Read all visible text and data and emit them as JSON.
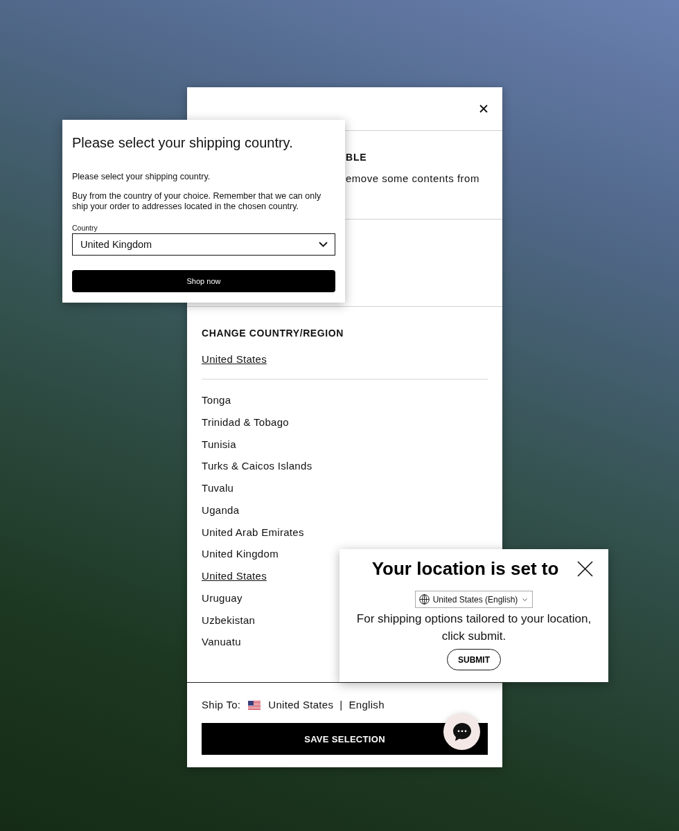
{
  "main_panel": {
    "notice": {
      "heading": "BLE",
      "text": "emove some contents from"
    },
    "change_country": {
      "heading": "CHANGE COUNTRY/REGION",
      "current_country": "United States",
      "countries": [
        {
          "name": "Tonga",
          "selected": false
        },
        {
          "name": "Trinidad & Tobago",
          "selected": false
        },
        {
          "name": "Tunisia",
          "selected": false
        },
        {
          "name": "Turks & Caicos Islands",
          "selected": false
        },
        {
          "name": "Tuvalu",
          "selected": false
        },
        {
          "name": "Uganda",
          "selected": false
        },
        {
          "name": "United Arab Emirates",
          "selected": false
        },
        {
          "name": "United Kingdom",
          "selected": false
        },
        {
          "name": "United States",
          "selected": true
        },
        {
          "name": "Uruguay",
          "selected": false
        },
        {
          "name": "Uzbekistan",
          "selected": false
        },
        {
          "name": "Vanuatu",
          "selected": false
        }
      ]
    },
    "footer": {
      "ship_to_label": "Ship To:",
      "country": "United States",
      "separator": "|",
      "language": "English",
      "save_button": "SAVE SELECTION"
    }
  },
  "shipping_popup": {
    "title": "Please select your shipping country.",
    "subtitle": "Please select your shipping country.",
    "text": "Buy from the country of your choice. Remember that we can only ship your order to addresses located in the chosen country.",
    "country_label": "Country",
    "country_value": "United Kingdom",
    "button": "Shop now"
  },
  "location_popup": {
    "title": "Your location is set to",
    "locale": "United States (English)",
    "text": "For shipping options tailored to your location, click submit.",
    "button": "SUBMIT"
  }
}
